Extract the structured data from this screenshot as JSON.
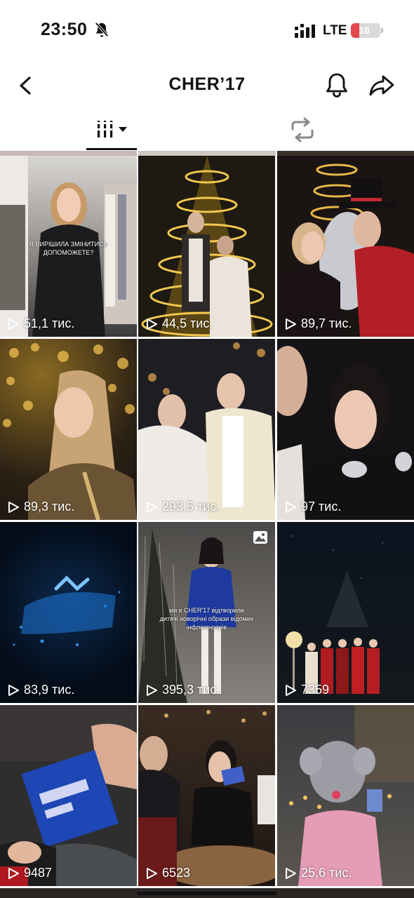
{
  "status": {
    "time": "23:50",
    "network": "LTE",
    "battery": "18",
    "battery_level": 0.18
  },
  "header": {
    "title": "CHER’17"
  },
  "icons": {
    "back": "chevron-left-icon",
    "notify": "bell-icon",
    "share": "share-arrow-icon",
    "videos_tab": "grid-columns-icon",
    "reposts_tab": "repost-icon",
    "play": "play-icon",
    "photo": "photo-icon"
  },
  "grid": [
    {
      "views": "51,1 тис.",
      "caption": "Я ВИРІШИЛА ЗМІНИТИСЬ ДОПОМОЖЕТЕ?",
      "bg": "#5e5a56"
    },
    {
      "views": "44,5 тис.",
      "bg": "#2a2418"
    },
    {
      "views": "89,7 тис.",
      "bg": "#2b1a16"
    },
    {
      "views": "89,3 тис.",
      "bg": "#2d2518"
    },
    {
      "views": "293,5 тис.",
      "bg": "#28282a"
    },
    {
      "views": "97 тис.",
      "bg": "#1c1a1c"
    },
    {
      "views": "83,9 тис.",
      "bg": "#05101e"
    },
    {
      "views": "395,3 тис.",
      "caption": "ми в CHER'17 відтворили дитячі новорічні образи відомих інфлюенсерів",
      "photo": true,
      "bg": "#6c6864"
    },
    {
      "views": "7359",
      "bg": "#0a1016"
    },
    {
      "views": "9487",
      "bg": "#3a3838"
    },
    {
      "views": "6523",
      "bg": "#2a201a"
    },
    {
      "views": "25,6 тис.",
      "bg": "#4a4844"
    }
  ],
  "colors": {
    "accent_dark": "#111111",
    "battery_low": "#e5484d"
  }
}
